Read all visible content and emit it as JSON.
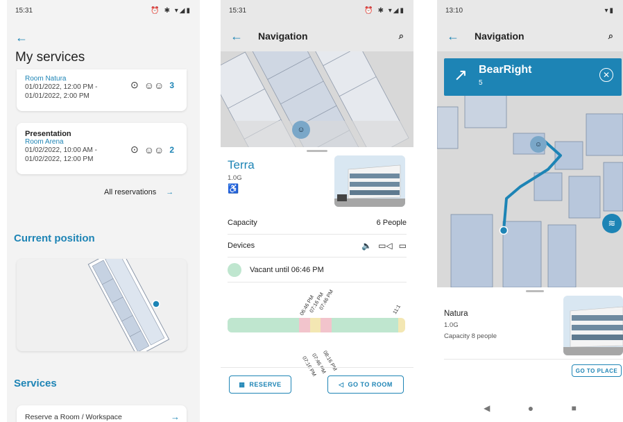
{
  "screen1": {
    "status": {
      "time": "15:31",
      "icons": "⏰ ✱ ▾◢▮"
    },
    "title": "My services",
    "services": [
      {
        "title": "",
        "room": "Room Natura",
        "time1": "01/01/2022, 12:00 PM -",
        "time2": "01/01/2022, 2:00 PM",
        "count": "3"
      },
      {
        "title": "Presentation",
        "room": "Room Arena",
        "time1": "01/02/2022, 10:00 AM -",
        "time2": "01/02/2022, 12:00 PM",
        "count": "2"
      }
    ],
    "all_reservations": "All reservations",
    "current_position": "Current position",
    "services_heading": "Services",
    "reserve_item": "Reserve a Room / Workspace"
  },
  "screen2": {
    "status": {
      "time": "15:31",
      "icons": "⏰ ✱ ▾◢▮"
    },
    "title": "Navigation",
    "room_name": "Terra",
    "floor": "1.0G",
    "capacity_label": "Capacity",
    "capacity_value": "6 People",
    "devices_label": "Devices",
    "vacancy": "Vacant until 06:46 PM",
    "timeline_top": [
      "06:46 PM",
      "07:16 PM",
      "07:46 PM",
      "11:1"
    ],
    "timeline_bottom": [
      "07:16 PM",
      "07:46 PM",
      "08:16 PM"
    ],
    "reserve_button": "RESERVE",
    "go_to_room_button": "GO TO ROOM"
  },
  "screen3": {
    "status": {
      "time": "13:10",
      "icons": "▾▮"
    },
    "title": "Navigation",
    "direction": "BearRight",
    "distance": "5",
    "place_name": "Natura",
    "floor": "1.0G",
    "capacity": "Capacity 8 people",
    "go_to_place": "GO TO PLACE"
  },
  "colors": {
    "accent": "#1d84b5",
    "vacant": "#bfe6cf",
    "booked": "#f2c4cc",
    "pending": "#f3e7b3",
    "map_room": "#b8c7dc"
  }
}
